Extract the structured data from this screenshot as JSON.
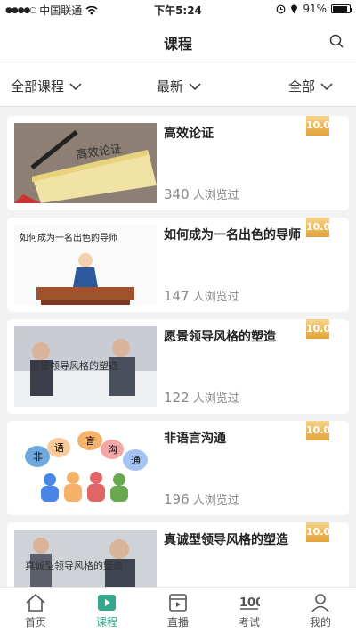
{
  "status": {
    "carrier": "中国联通",
    "time": "下午5:24",
    "battery": "91%",
    "battery_level": 0.91
  },
  "nav": {
    "title": "课程"
  },
  "filters": [
    {
      "label": "全部课程"
    },
    {
      "label": "最新"
    },
    {
      "label": "全部"
    }
  ],
  "courses": [
    {
      "title": "高效论证",
      "views": "340",
      "views_suffix": "人浏览过",
      "score": "10.0",
      "thumb_text": "高效论证"
    },
    {
      "title": "如何成为一名出色的导师",
      "views": "147",
      "views_suffix": "人浏览过",
      "score": "10.0",
      "thumb_text": "如何成为一名出色的导师"
    },
    {
      "title": "愿景领导风格的塑造",
      "views": "122",
      "views_suffix": "人浏览过",
      "score": "10.0",
      "thumb_text": "愿景领导风格的塑造"
    },
    {
      "title": "非语言沟通",
      "views": "196",
      "views_suffix": "人浏览过",
      "score": "10.0",
      "thumb_text": [
        "非",
        "语",
        "言",
        "沟",
        "通"
      ]
    },
    {
      "title": "真诚型领导风格的塑造",
      "views": "",
      "views_suffix": "",
      "score": "10.0",
      "thumb_text": "真诚型领导风格的塑造"
    }
  ],
  "tabs": [
    {
      "label": "首页",
      "icon": "home-icon"
    },
    {
      "label": "课程",
      "icon": "play-icon",
      "active": true
    },
    {
      "label": "直播",
      "icon": "live-icon"
    },
    {
      "label": "考试",
      "icon": "exam-icon"
    },
    {
      "label": "我的",
      "icon": "user-icon"
    }
  ],
  "colors": {
    "accent": "#35a78d",
    "score_badge": "#e3a23a"
  }
}
